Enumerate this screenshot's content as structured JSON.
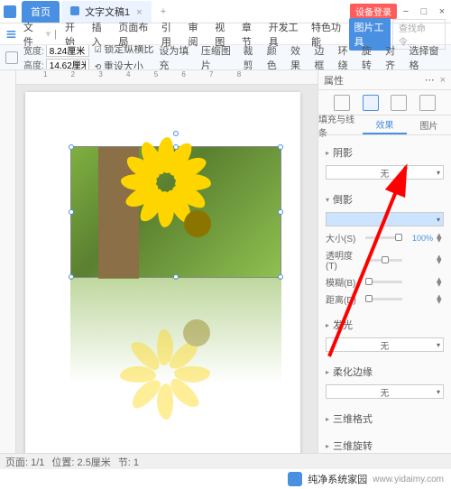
{
  "titlebar": {
    "tabs": [
      {
        "label": "首页",
        "type": "home"
      },
      {
        "label": "文字文稿1",
        "type": "doc"
      }
    ],
    "beta": "设备登录"
  },
  "menubar": {
    "file": "文件",
    "items": [
      "开始",
      "插入",
      "页面布局",
      "引用",
      "审阅",
      "视图",
      "章节",
      "开发工具",
      "特色功能",
      "图片工具"
    ],
    "search_placeholder": "查找命令..."
  },
  "ribbon": {
    "width_label": "宽度:",
    "width_val": "8.24厘米",
    "height_label": "高度:",
    "height_val": "14.62厘米",
    "lock": "锁定纵横比",
    "reset": "重设大小",
    "g1": "设为填充",
    "g2": "压缩图片",
    "g3": "裁剪",
    "g4": "颜色",
    "g5": "效果",
    "g6": "边框",
    "g7": "环绕",
    "g8": "旋转",
    "g9": "对齐",
    "g10": "选择窗格"
  },
  "props": {
    "title": "属性",
    "tabs": {
      "fill": "填充与线条",
      "effect": "效果",
      "pic": "图片"
    },
    "sections": {
      "shadow": "阴影",
      "reflection": "倒影",
      "glow": "发光",
      "soft": "柔化边缘",
      "threed": "三维格式",
      "rotate": "三维旋转"
    },
    "none": "无",
    "reflection_fields": {
      "size": "大小(S)",
      "size_val": "100%",
      "transparency": "透明度(T)",
      "blur": "模糊(B)",
      "distance": "距离(D)"
    }
  },
  "statusbar": {
    "page": "页面: 1/1",
    "pos": "位置: 2.5厘米",
    "sec": "节: 1"
  },
  "watermark": {
    "name": "纯净系统家园",
    "url": "www.yidaimy.com"
  }
}
